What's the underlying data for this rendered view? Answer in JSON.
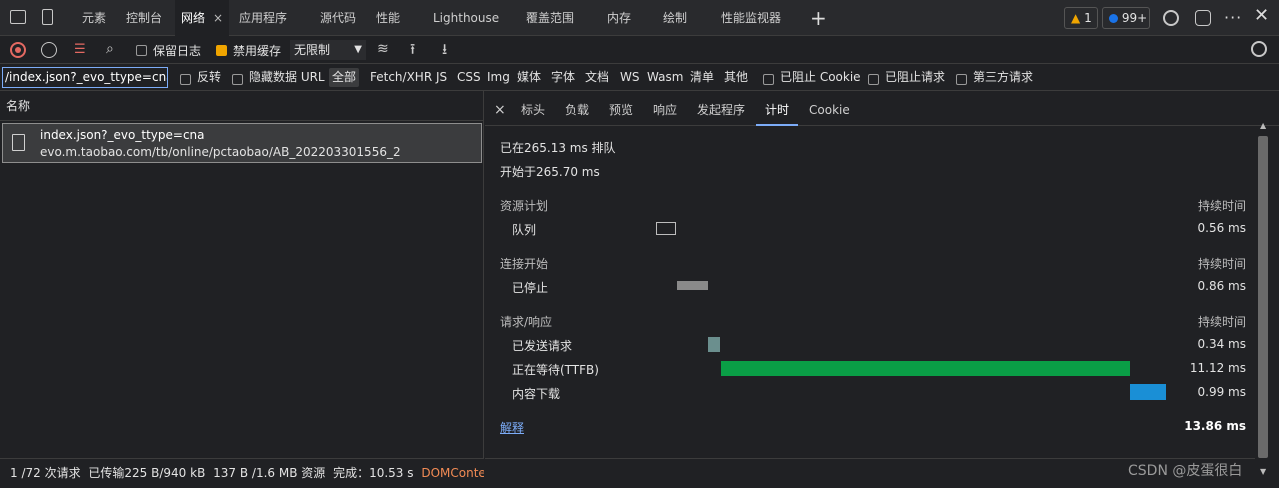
{
  "top_tabs": {
    "elements": "元素",
    "console": "控制台",
    "network": "网络",
    "close": "×",
    "application": "应用程序",
    "sources": "源代码",
    "performance": "性能",
    "lighthouse": "Lighthouse",
    "coverage": "覆盖范围",
    "memory": "内存",
    "rendering": "绘制",
    "perf_monitor": "性能监视器",
    "add": "+"
  },
  "badges": {
    "warnings": "1",
    "messages": "99+"
  },
  "toolbar": {
    "preserve_log": "保留日志",
    "disable_cache": "禁用缓存",
    "throttling": "无限制"
  },
  "filter": {
    "value": "/index.json?_evo_ttype=cna",
    "invert": "反转",
    "hide_data_urls": "隐藏数据 URL",
    "types": [
      "全部",
      "Fetch/XHR",
      "JS",
      "CSS",
      "Img",
      "媒体",
      "字体",
      "文档",
      "WS",
      "Wasm",
      "清单",
      "其他"
    ],
    "blocked_cookies": "已阻止 Cookie",
    "blocked_requests": "已阻止请求",
    "third_party": "第三方请求"
  },
  "requests": {
    "column_name": "名称",
    "item_name": "index.json?_evo_ttype=cna",
    "item_path": "evo.m.taobao.com/tb/online/pctaobao/AB_202203301556_2"
  },
  "status": {
    "requests": "1 /72 次请求",
    "transferred": "已传输225 B/940 kB",
    "resources": "137 B /1.6 MB 资源",
    "finish": "完成：10.53 s",
    "dcl": "DOMContentLoad"
  },
  "detail_tabs": {
    "close": "×",
    "headers": "标头",
    "payload": "负载",
    "preview": "预览",
    "response": "响应",
    "initiator": "发起程序",
    "timing": "计时",
    "cookie": "Cookie"
  },
  "timing": {
    "queued_at": "已在265.13 ms 排队",
    "started_at": "开始于265.70 ms",
    "duration_label": "持续时间",
    "sections": [
      {
        "title": "资源计划",
        "rows": [
          {
            "label": "队列",
            "value": "0.56 ms"
          }
        ]
      },
      {
        "title": "连接开始",
        "rows": [
          {
            "label": "已停止",
            "value": "0.86 ms"
          }
        ]
      },
      {
        "title": "请求/响应",
        "rows": [
          {
            "label": "已发送请求",
            "value": "0.34 ms"
          },
          {
            "label": "正在等待(TTFB)",
            "value": "11.12 ms"
          },
          {
            "label": "内容下载",
            "value": "0.99 ms"
          }
        ]
      }
    ],
    "explanation": "解释",
    "total": "13.86 ms"
  },
  "watermark": "CSDN @皮蛋很白",
  "colors": {
    "ttfb": "#0a9e46",
    "download": "#1a8fd6",
    "sent": "#6b8f8e",
    "stalled": "#8a8a8a",
    "link": "#7cacf8",
    "record": "#e46962"
  }
}
